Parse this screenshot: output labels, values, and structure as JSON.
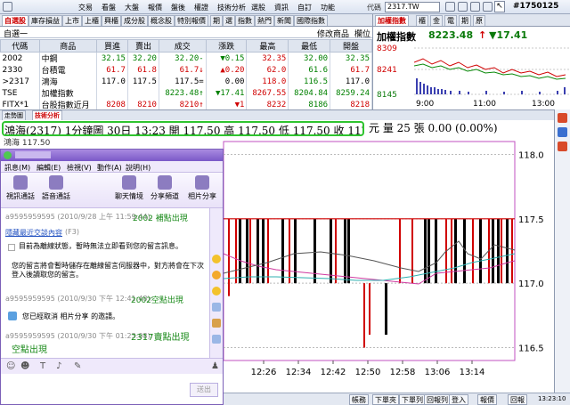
{
  "menubar": {
    "items": [
      "交易",
      "看盤",
      "大盤",
      "報價",
      "盤後",
      "權證",
      "技術分析",
      "選股",
      "資訊",
      "自訂",
      "功能"
    ],
    "code_label": "代碼",
    "code_value": "2317.TW",
    "id_badge": "#1750125"
  },
  "quote_tabs": [
    "自選股",
    "庫存損益",
    "上市",
    "上櫃",
    "興櫃",
    "成分股",
    "概念股",
    "特別報價",
    "期",
    "選",
    "指數",
    "熱門",
    "新聞",
    "國際指數"
  ],
  "group_bar": {
    "group": "自選一",
    "edit": "修改商品",
    "column": "欄位"
  },
  "quote_table": {
    "headers": [
      "代碼",
      "商品",
      "買進",
      "賣出",
      "成交",
      "漲跌",
      "最高",
      "最低",
      "開盤"
    ],
    "rows": [
      {
        "code": "2002",
        "name": "中鋼",
        "bid": "32.15",
        "ask": "32.20",
        "last": "32.20",
        "last_mark": "-",
        "change": "▼0.15",
        "high": "32.35",
        "low": "32.00",
        "open": "32.35",
        "color": "green"
      },
      {
        "code": "2330",
        "name": "台積電",
        "bid": "61.7",
        "ask": "61.8",
        "last": "61.7",
        "last_mark": "↓",
        "change": "▲0.20",
        "high": "62.0",
        "low": "61.6",
        "open": "61.7",
        "color": "red"
      },
      {
        "code": ">2317",
        "name": "鴻海",
        "bid": "117.0",
        "ask": "117.5",
        "last": "117.5",
        "last_mark": "=",
        "change": "0.00",
        "high": "118.0",
        "low": "116.5",
        "open": "117.0",
        "color": "black"
      },
      {
        "code": "TSE",
        "name": "加權指數",
        "bid": "",
        "ask": "",
        "last": "8223.48",
        "last_mark": "↑",
        "change": "▼17.41",
        "high": "8267.55",
        "low": "8204.84",
        "open": "8259.24",
        "color": "green"
      },
      {
        "code": "FITX*1",
        "name": "台股指數近月",
        "bid": "8208",
        "ask": "8210",
        "last": "8210",
        "last_mark": "↑",
        "change": "▼1",
        "high": "8232",
        "low": "8186",
        "open": "8218",
        "color": "red"
      }
    ]
  },
  "index_panel": {
    "tabs": [
      "加權指數",
      "櫃",
      "金",
      "電",
      "期",
      "原"
    ],
    "name": "加權指數",
    "value": "8223.48",
    "value_mark": "↑",
    "change": "▼17.41",
    "y_ticks": [
      "8309",
      "8241",
      "8145"
    ],
    "x_ticks": [
      "9:00",
      "11:00",
      "13:00"
    ]
  },
  "chart_tabs": [
    "走勢圖",
    "技術分析"
  ],
  "chart_header": {
    "title": "鴻海(2317) 1分鐘圖 30日 13:23 開 117.50 高 117.50 低 117.50 收 117.50",
    "tail": "元 量 25 張 0.00 (0.00%)",
    "legend": "鴻海 117.50"
  },
  "chart_data": {
    "type": "bar",
    "x_ticks": [
      "12:26",
      "12:34",
      "12:42",
      "12:50",
      "12:58",
      "13:06",
      "13:14"
    ],
    "y_ticks": [
      "118.0",
      "117.5",
      "117.0",
      "116.5"
    ],
    "ylim": [
      116.4,
      118.1
    ]
  },
  "statusbar": {
    "buttons": [
      "帳務",
      "下單夾",
      "下單列",
      "回報列",
      "登入",
      "報價",
      "回報"
    ],
    "time": "13:23:10"
  },
  "messenger": {
    "menu": [
      "訊息(M)",
      "編輯(E)",
      "檢視(V)",
      "動作(A)",
      "說明(H)"
    ],
    "tools": [
      "視訊通話",
      "語音通話",
      "聊天情境",
      "分享頻道",
      "相片分享"
    ],
    "lines": [
      {
        "meta": "a9595959595 (2010/9/28 上午 11:59:44):",
        "text": "2002 補點出現"
      },
      {
        "link": "隱藏最近交談內容",
        "suffix": "(F3)"
      },
      {
        "text": "目前為離線狀態，暫時無法立即看到您的留言訊息。"
      },
      {
        "text": "您的留言將會暫時儲存在離線留言伺服器中，對方將會在下次登入後讀取您的留言。"
      },
      {
        "meta": "a9595959595 (2010/9/30 下午 12:41:48):",
        "text": "2002空點出現"
      },
      {
        "text": "您已經取消 相片分享 的邀請。"
      },
      {
        "meta": "a9595959595 (2010/9/30 下午 01:23:08):",
        "text": "2317賣點出現"
      },
      {
        "text": "空點出現"
      }
    ],
    "send": "送出"
  }
}
